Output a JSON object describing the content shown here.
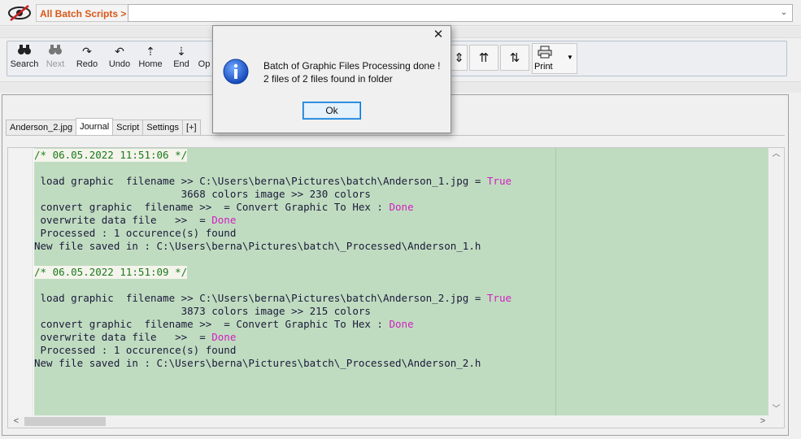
{
  "topbar": {
    "scripts_label": "All Batch Scripts >",
    "combo_arrow": "⌄"
  },
  "toolbar": {
    "search": "Search",
    "next": "Next",
    "redo": "Redo",
    "undo": "Undo",
    "home": "Home",
    "end": "End",
    "op_partial": "Op",
    "print": "Print"
  },
  "tabs": [
    "Anderson_2.jpg",
    "Journal",
    "Script",
    "Settings",
    "[+]"
  ],
  "active_tab": "Journal",
  "journal": {
    "lines": [
      {
        "type": "header",
        "text": "/* 06.05.2022 11:51:06 */"
      },
      {
        "type": "blank",
        "text": ""
      },
      {
        "type": "load",
        "prefix": " load graphic  filename >> C:\\Users\\berna\\Pictures\\batch\\Anderson_1.jpg = ",
        "highlight": "True"
      },
      {
        "type": "plain",
        "text": "                        3668 colors image >> 230 colors"
      },
      {
        "type": "conv",
        "prefix": " convert graphic  filename >>  = Convert Graphic To Hex : ",
        "highlight": "Done"
      },
      {
        "type": "conv",
        "prefix": " overwrite data file   >>  = ",
        "highlight": "Done"
      },
      {
        "type": "plain",
        "text": " Processed : 1 occurence(s) found"
      },
      {
        "type": "plain",
        "text": "New file saved in : C:\\Users\\berna\\Pictures\\batch\\_Processed\\Anderson_1.h"
      },
      {
        "type": "blank",
        "text": ""
      },
      {
        "type": "header",
        "text": "/* 06.05.2022 11:51:09 */"
      },
      {
        "type": "blank",
        "text": ""
      },
      {
        "type": "load",
        "prefix": " load graphic  filename >> C:\\Users\\berna\\Pictures\\batch\\Anderson_2.jpg = ",
        "highlight": "True"
      },
      {
        "type": "plain",
        "text": "                        3873 colors image >> 215 colors"
      },
      {
        "type": "conv",
        "prefix": " convert graphic  filename >>  = Convert Graphic To Hex : ",
        "highlight": "Done"
      },
      {
        "type": "conv",
        "prefix": " overwrite data file   >>  = ",
        "highlight": "Done"
      },
      {
        "type": "plain",
        "text": " Processed : 1 occurence(s) found"
      },
      {
        "type": "plain",
        "text": "New file saved in : C:\\Users\\berna\\Pictures\\batch\\_Processed\\Anderson_2.h"
      }
    ]
  },
  "dialog": {
    "message_line1": "Batch of Graphic Files Processing done !",
    "message_line2": "2 files of 2 files found in folder",
    "ok_label": "Ok",
    "close_glyph": "✕",
    "icon": "info-icon"
  },
  "colors": {
    "editor_bg": "#c0dcc0",
    "highlight": "#d020c0",
    "header_text": "#1a7a1a",
    "scripts_label": "#d9581a",
    "accent": "#0078d7"
  }
}
